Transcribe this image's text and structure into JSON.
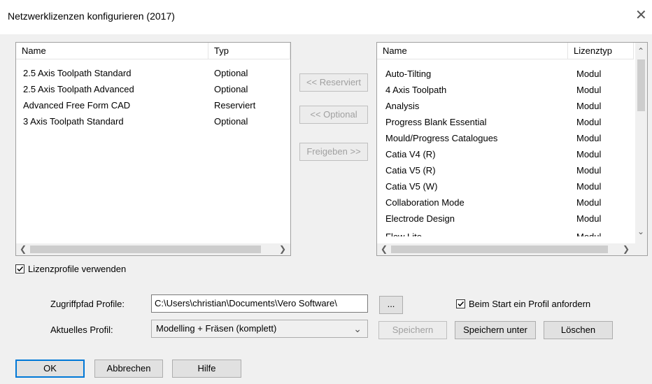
{
  "window": {
    "title": "Netzwerklizenzen konfigurieren (2017)",
    "close_glyph": "✕"
  },
  "left_list": {
    "columns": [
      "Name",
      "Typ"
    ],
    "rows": [
      {
        "name": "2.5 Axis Toolpath Standard",
        "type": "Optional"
      },
      {
        "name": "2.5 Axis Toolpath Advanced",
        "type": "Optional"
      },
      {
        "name": "Advanced Free Form CAD",
        "type": "Reserviert"
      },
      {
        "name": "3 Axis Toolpath Standard",
        "type": "Optional"
      }
    ]
  },
  "middle_buttons": {
    "reserviert": "<< Reserviert",
    "optional": "<< Optional",
    "freigeben": "Freigeben >>"
  },
  "right_list": {
    "columns": [
      "Name",
      "Lizenztyp"
    ],
    "rows": [
      {
        "name": "Auto-Tilting",
        "type": "Modul"
      },
      {
        "name": "4 Axis Toolpath",
        "type": "Modul"
      },
      {
        "name": "Analysis",
        "type": "Modul"
      },
      {
        "name": "Progress Blank Essential",
        "type": "Modul"
      },
      {
        "name": "Mould/Progress Catalogues",
        "type": "Modul"
      },
      {
        "name": "Catia V4 (R)",
        "type": "Modul"
      },
      {
        "name": "Catia V5 (R)",
        "type": "Modul"
      },
      {
        "name": "Catia V5 (W)",
        "type": "Modul"
      },
      {
        "name": "Collaboration Mode",
        "type": "Modul"
      },
      {
        "name": "Electrode Design",
        "type": "Modul"
      },
      {
        "name": "Flow Lite",
        "type": "Modul"
      }
    ]
  },
  "profiles": {
    "use_profiles_label": "Lizenzprofile verwenden",
    "use_profiles_checked": true,
    "path_label": "Zugriffpfad Profile:",
    "path_value": "C:\\Users\\christian\\Documents\\Vero Software\\",
    "browse_label": "...",
    "request_on_start_label": "Beim Start ein Profil anfordern",
    "request_on_start_checked": true,
    "current_label": "Aktuelles Profil:",
    "current_value": "Modelling + Fräsen (komplett)",
    "save_label": "Speichern",
    "save_as_label": "Speichern unter",
    "delete_label": "Löschen"
  },
  "footer": {
    "ok": "OK",
    "cancel": "Abbrechen",
    "help": "Hilfe"
  },
  "icons": {
    "left_arrow": "❮",
    "right_arrow": "❯",
    "up_arrow": "⌃",
    "down_arrow": "⌄",
    "dropdown": "⌄"
  }
}
